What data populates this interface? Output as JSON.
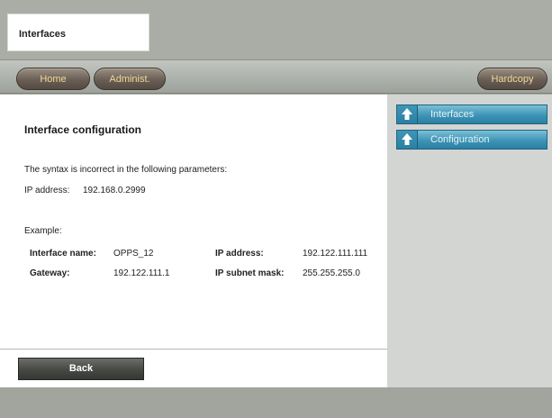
{
  "header": {
    "title": "Interfaces"
  },
  "nav": {
    "home": "Home",
    "admin": "Administ.",
    "hardcopy": "Hardcopy"
  },
  "main": {
    "heading": "Interface configuration",
    "error_message": "The syntax is incorrect in the following parameters:",
    "error_param_label": "IP address:",
    "error_param_value": "192.168.0.2999",
    "example_label": "Example:",
    "example": {
      "interface_name_label": "Interface name:",
      "interface_name_value": "OPPS_12",
      "ip_address_label": "IP address:",
      "ip_address_value": "192.122.111.111",
      "gateway_label": "Gateway:",
      "gateway_value": "192.122.111.1",
      "subnet_mask_label": "IP subnet mask:",
      "subnet_mask_value": "255.255.255.0"
    }
  },
  "sidebar": {
    "items": [
      {
        "label": "Interfaces",
        "icon": "up-arrow-icon"
      },
      {
        "label": "Configuration",
        "icon": "up-arrow-icon"
      }
    ]
  },
  "footer": {
    "back": "Back"
  },
  "colors": {
    "frame": "#a9ada6",
    "pill_button": "#6a5f55",
    "pill_text": "#f2d896",
    "side_item": "#3d94b6",
    "back_button": "#494b47"
  }
}
